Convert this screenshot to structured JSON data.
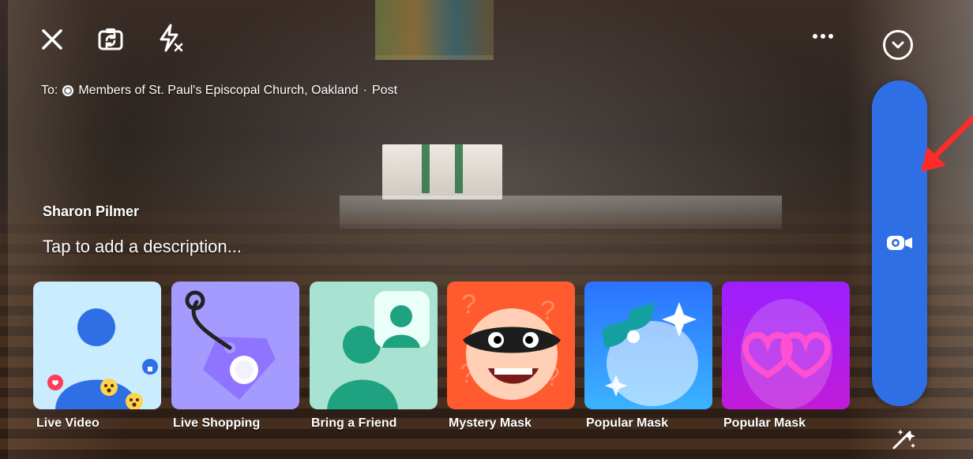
{
  "top_bar": {
    "close_icon": "close-icon",
    "flip_camera_icon": "flip-camera-icon",
    "flash_icon": "flash-off-icon",
    "more_icon": "more-icon",
    "collapse_icon": "chevron-down-icon"
  },
  "post": {
    "to_prefix": "To:",
    "audience": "Members of St. Paul's Episcopal Church, Oakland",
    "separator": " · ",
    "post_type": "Post"
  },
  "user": {
    "name": "Sharon Pilmer"
  },
  "composer": {
    "description_placeholder": "Tap to add a description..."
  },
  "effects": [
    {
      "label": "Live Video"
    },
    {
      "label": "Live Shopping"
    },
    {
      "label": "Bring a Friend"
    },
    {
      "label": "Mystery Mask"
    },
    {
      "label": "Popular Mask"
    },
    {
      "label": "Popular Mask"
    }
  ],
  "right_controls": {
    "record_icon": "video-camera-icon",
    "effects_icon": "magic-wand-icon",
    "pill_color": "#2f6fe6"
  },
  "annotation": {
    "arrow_color": "#ff2a2a"
  }
}
